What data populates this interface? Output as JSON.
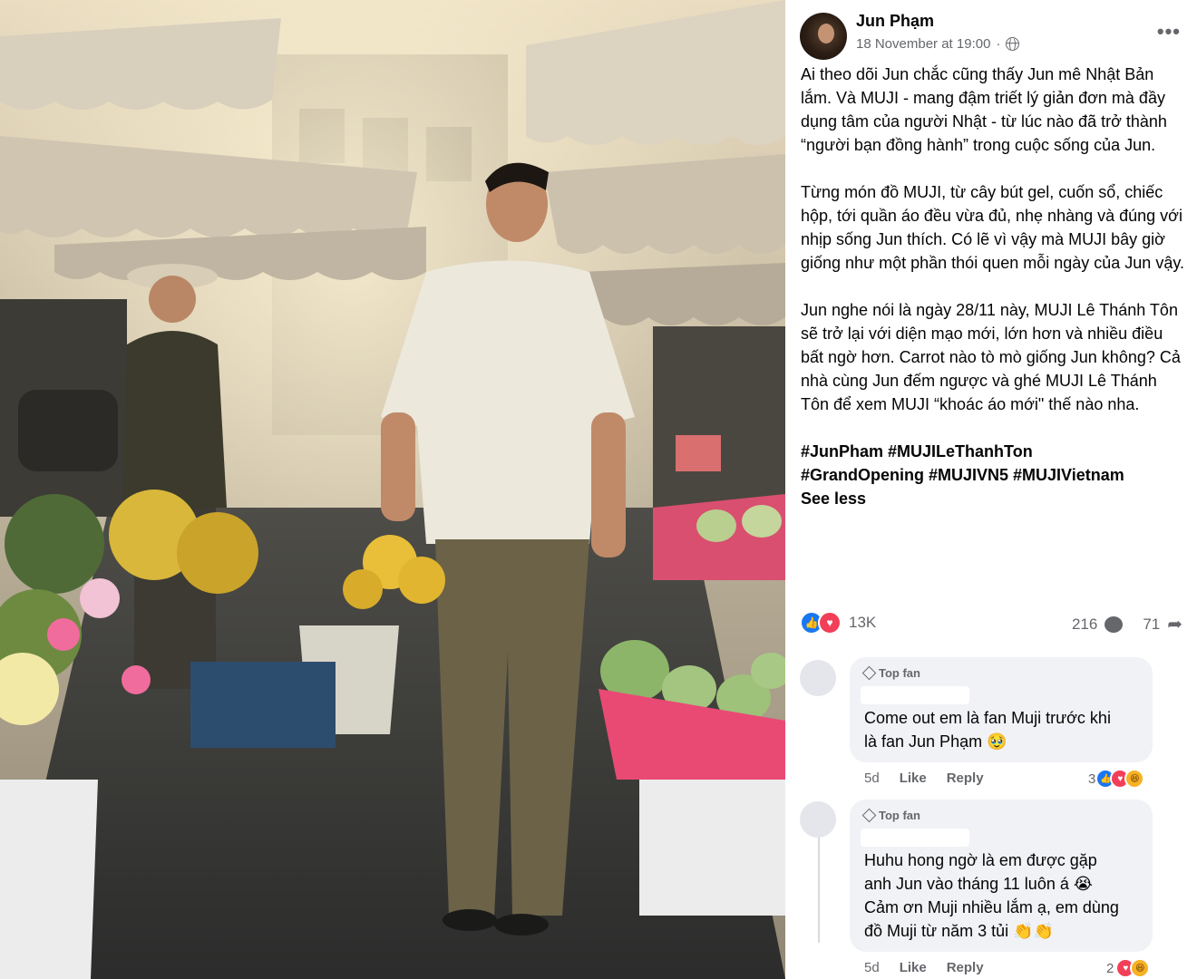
{
  "post": {
    "author": "Jun Phạm",
    "timestamp": "18 November at 19:00",
    "separator": "·",
    "more_label": "•••",
    "paragraphs": [
      "Ai theo dõi Jun chắc cũng thấy Jun mê Nhật Bản lắm. Và MUJI - mang đậm triết lý giản đơn mà đầy dụng tâm của người Nhật - từ lúc nào đã trở thành “người bạn đồng hành” trong cuộc sống của Jun.",
      "Từng món đồ MUJI, từ cây bút gel, cuốn sổ, chiếc hộp, tới quần áo đều vừa đủ, nhẹ nhàng và đúng với nhịp sống Jun thích. Có lẽ vì vậy mà MUJI bây giờ giống như một phần thói quen mỗi ngày của Jun vậy.",
      "Jun nghe nói là ngày 28/11 này, MUJI Lê Thánh Tôn sẽ trở lại với diện mạo mới, lớn hơn và nhiều điều bất ngờ hơn. Carrot nào tò mò giống Jun không? Cả nhà cùng Jun đếm ngược và ghé MUJI Lê Thánh Tôn để xem MUJI “khoác áo mới\" thế nào nha."
    ],
    "hashtags_line1": "#JunPham #MUJILeThanhTon",
    "hashtags_line2": "#GrandOpening #MUJIVN5 #MUJIVietnam",
    "see_less": "See less",
    "reaction_count": "13K",
    "comment_count": "216",
    "share_count": "71",
    "reaction_icons": [
      "like-icon",
      "love-icon"
    ]
  },
  "comments": [
    {
      "badge": "Top fan",
      "text_lines": [
        "Come out em là fan Muji trước khi",
        "là fan Jun Phạm 🥹"
      ],
      "age": "5d",
      "like": "Like",
      "reply": "Reply",
      "reaction_count": "3",
      "reaction_icons": [
        "like-icon",
        "love-icon",
        "haha-icon"
      ]
    },
    {
      "badge": "Top fan",
      "text_lines": [
        "Huhu hong ngờ là em được gặp",
        "anh Jun vào tháng 11 luôn á 😭",
        "Cảm ơn Muji nhiều lắm ạ, em dùng",
        "đồ Muji từ năm 3 tủi 👏👏"
      ],
      "age": "5d",
      "like": "Like",
      "reply": "Reply",
      "reaction_count": "2",
      "reaction_icons": [
        "love-icon",
        "haha-icon"
      ]
    }
  ],
  "colors": {
    "text": "#050505",
    "secondary": "#65676b",
    "like_blue": "#1877f2",
    "love_red": "#f33e58",
    "haha_yellow": "#f7b125",
    "comment_bg": "#f0f2f5"
  }
}
